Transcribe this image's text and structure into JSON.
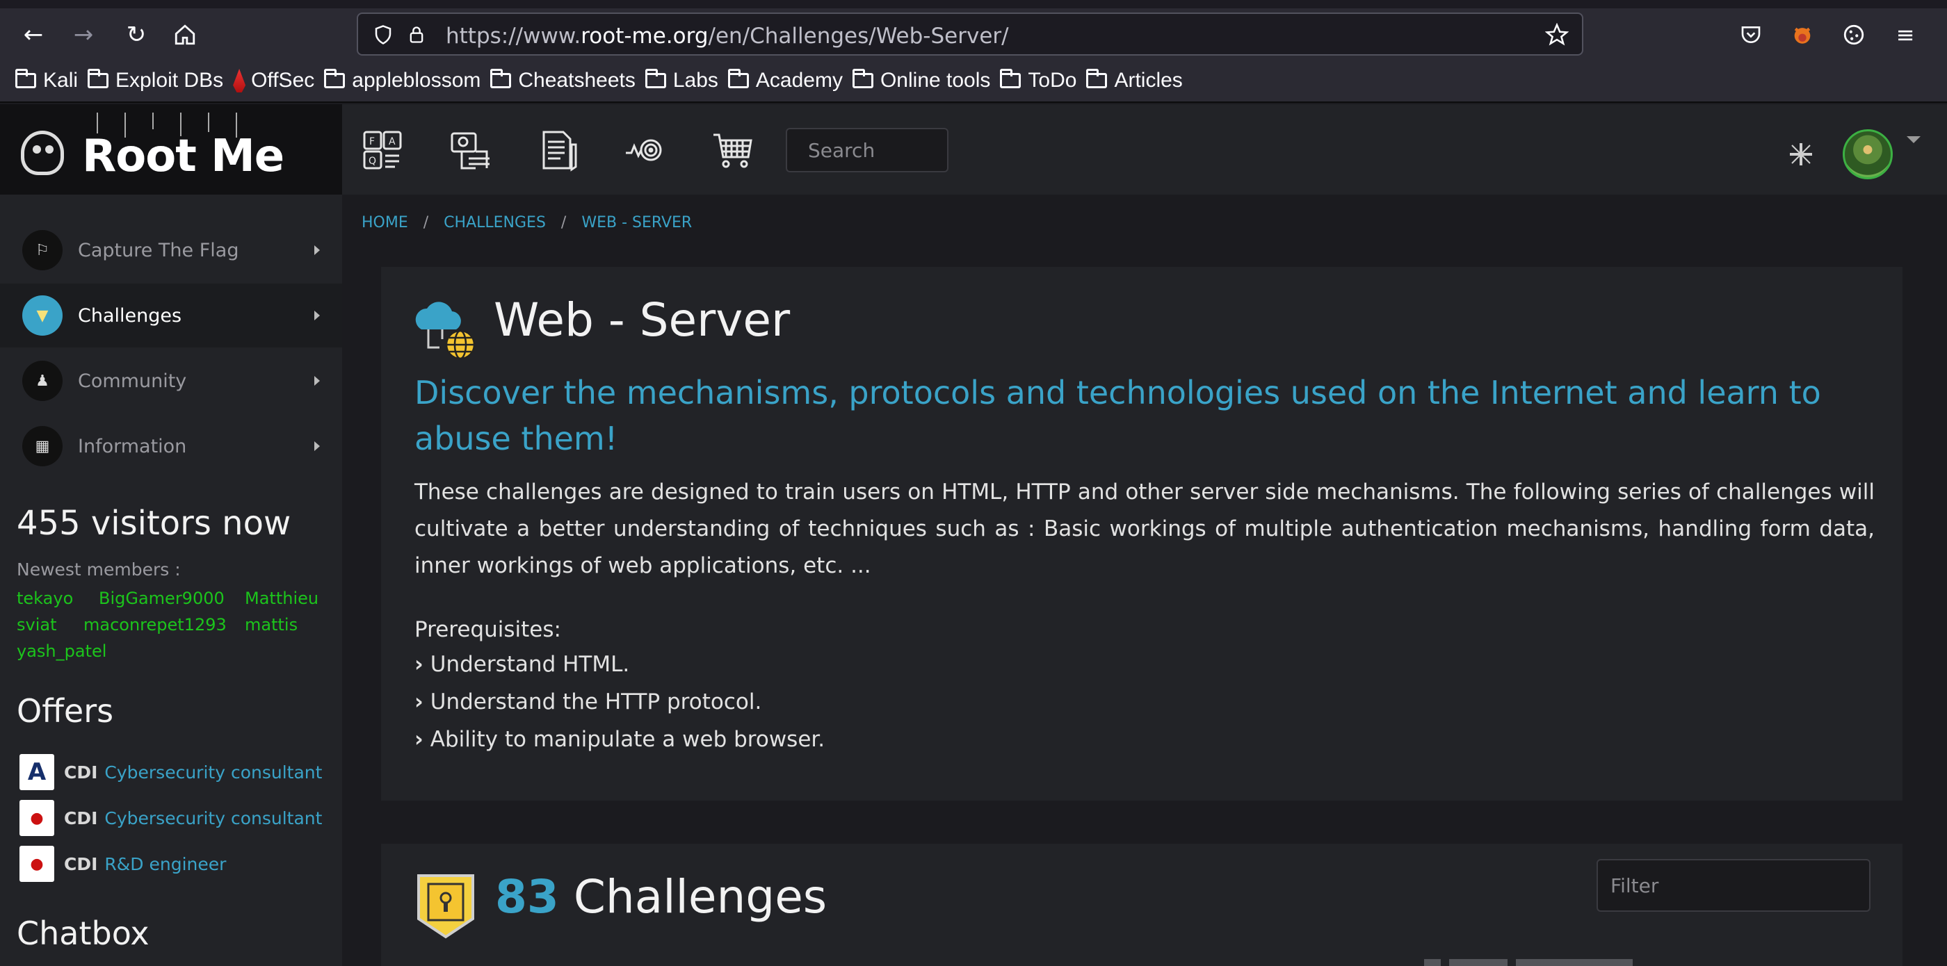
{
  "browser": {
    "url_prefix": "https://www.",
    "url_domain": "root-me.org",
    "url_path": "/en/Challenges/Web-Server/",
    "bookmarks": [
      "Kali",
      "Exploit DBs",
      "OffSec",
      "appleblossom",
      "Cheatsheets",
      "Labs",
      "Academy",
      "Online tools",
      "ToDo",
      "Articles"
    ]
  },
  "header": {
    "logo_text": "Root Me",
    "search_placeholder": "Search"
  },
  "sidebar": {
    "items": [
      {
        "label": "Capture The Flag",
        "icon": "flag-icon"
      },
      {
        "label": "Challenges",
        "icon": "challenge-badge-icon"
      },
      {
        "label": "Community",
        "icon": "community-icon"
      },
      {
        "label": "Information",
        "icon": "info-icon"
      }
    ],
    "visitors": "455 visitors now",
    "newest_label": "Newest members :",
    "members": [
      "tekayo",
      "BigGamer9000",
      "Matthieu",
      "sviat",
      "maconrepet1293",
      "mattis",
      "yash_patel"
    ],
    "offers_title": "Offers",
    "offers": [
      {
        "type": "CDI",
        "title": "Cybersecurity consultant"
      },
      {
        "type": "CDI",
        "title": "Cybersecurity consultant"
      },
      {
        "type": "CDI",
        "title": "R&D engineer"
      }
    ],
    "chatbox_title": "Chatbox"
  },
  "breadcrumb": [
    "HOME",
    "CHALLENGES",
    "WEB - SERVER"
  ],
  "main": {
    "title": "Web - Server",
    "subtitle": "Discover the mechanisms, protocols and technologies used on the Internet and learn to abuse them!",
    "description": "These challenges are designed to train users on HTML, HTTP and other server side mechanisms. The following series of challenges will cultivate a better understanding of techniques such as : Basic workings of multiple authentication mechanisms, handling form data, inner workings of web applications, etc. ...",
    "prereq_title": "Prerequisites:",
    "prerequisites": [
      "Understand HTML.",
      "Understand the HTTP protocol.",
      "Ability to manipulate a web browser."
    ],
    "challenge_count": "83",
    "challenge_word": "Challenges",
    "filter_placeholder": "Filter"
  },
  "colors": {
    "accent": "#3aa3c8",
    "member_green": "#1cc41c",
    "panel": "#222327",
    "background": "#1b1b1f"
  }
}
